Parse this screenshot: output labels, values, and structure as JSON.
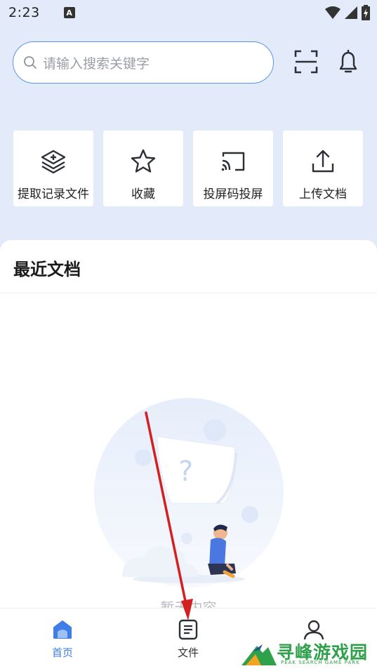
{
  "status_bar": {
    "time": "2:23",
    "notification_letter": "A"
  },
  "search": {
    "placeholder": "请输入搜索关键字"
  },
  "quick_actions": [
    {
      "label": "提取记录文件",
      "icon": "layers-add-icon"
    },
    {
      "label": "收藏",
      "icon": "star-icon"
    },
    {
      "label": "投屏码投屏",
      "icon": "cast-icon"
    },
    {
      "label": "上传文档",
      "icon": "upload-icon"
    }
  ],
  "recent": {
    "title": "最近文档",
    "empty_text": "暂无内容"
  },
  "bottom_nav": {
    "items": [
      {
        "label": "首页",
        "icon": "home-icon",
        "active": true
      },
      {
        "label": "文件",
        "icon": "file-icon",
        "active": false
      },
      {
        "label": "",
        "icon": "profile-icon",
        "active": false
      }
    ]
  },
  "watermark": {
    "name": "寻峰游戏园",
    "subtitle": "PEAK SEARCH GAME PARK"
  },
  "colors": {
    "accent": "#3f7ee8",
    "header_bg": "#e3ebfb",
    "annotation": "#d32020"
  }
}
